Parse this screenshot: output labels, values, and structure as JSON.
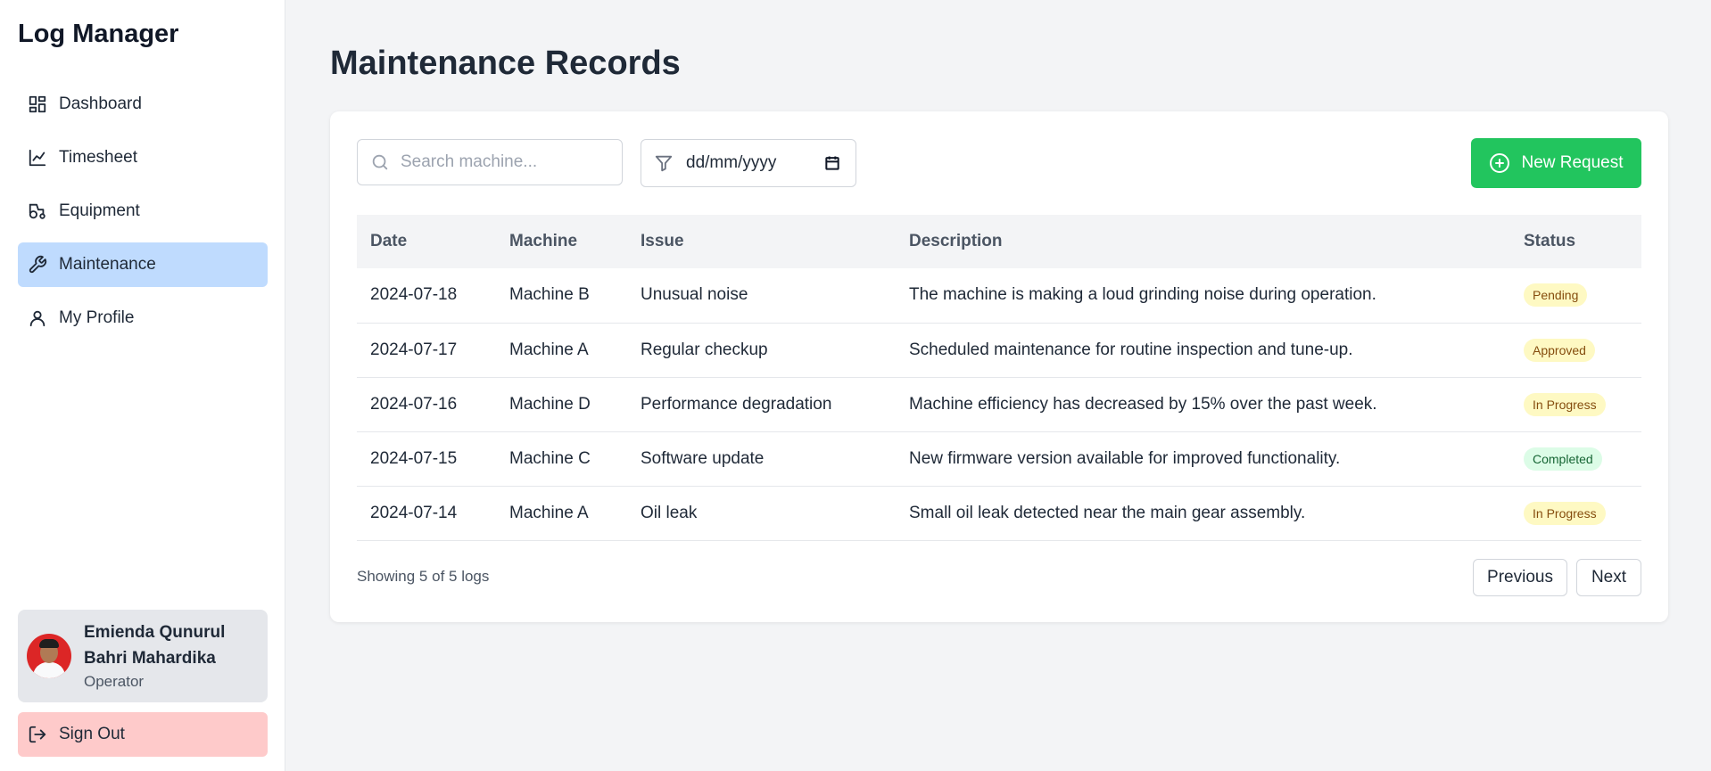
{
  "app": {
    "title": "Log Manager"
  },
  "sidebar": {
    "items": [
      {
        "label": "Dashboard",
        "icon": "layout-grid-icon",
        "active": false
      },
      {
        "label": "Timesheet",
        "icon": "line-chart-icon",
        "active": false
      },
      {
        "label": "Equipment",
        "icon": "tractor-icon",
        "active": false
      },
      {
        "label": "Maintenance",
        "icon": "wrench-icon",
        "active": true
      },
      {
        "label": "My Profile",
        "icon": "user-icon",
        "active": false
      }
    ],
    "user": {
      "name": "Emienda Qunurul Bahri Mahardika",
      "role": "Operator"
    },
    "signout_label": "Sign Out"
  },
  "main": {
    "title": "Maintenance Records",
    "search": {
      "placeholder": "Search machine...",
      "value": ""
    },
    "date_filter": {
      "value": "dd/mm/yyyy"
    },
    "new_request_label": "New Request",
    "table": {
      "headers": [
        "Date",
        "Machine",
        "Issue",
        "Description",
        "Status"
      ],
      "rows": [
        {
          "date": "2024-07-18",
          "machine": "Machine B",
          "issue": "Unusual noise",
          "description": "The machine is making a loud grinding noise during operation.",
          "status": "Pending"
        },
        {
          "date": "2024-07-17",
          "machine": "Machine A",
          "issue": "Regular checkup",
          "description": "Scheduled maintenance for routine inspection and tune-up.",
          "status": "Approved"
        },
        {
          "date": "2024-07-16",
          "machine": "Machine D",
          "issue": "Performance degradation",
          "description": "Machine efficiency has decreased by 15% over the past week.",
          "status": "In Progress"
        },
        {
          "date": "2024-07-15",
          "machine": "Machine C",
          "issue": "Software update",
          "description": "New firmware version available for improved functionality.",
          "status": "Completed"
        },
        {
          "date": "2024-07-14",
          "machine": "Machine A",
          "issue": "Oil leak",
          "description": "Small oil leak detected near the main gear assembly.",
          "status": "In Progress"
        }
      ]
    },
    "footer": {
      "showing": "Showing 5 of 5 logs",
      "previous_label": "Previous",
      "next_label": "Next"
    }
  },
  "colors": {
    "active_nav": "#bfdbfe",
    "signout_bg": "#fecaca",
    "primary_button": "#22c55e",
    "badge_yellow_bg": "#fef9c3",
    "badge_green_bg": "#dcfce7"
  }
}
